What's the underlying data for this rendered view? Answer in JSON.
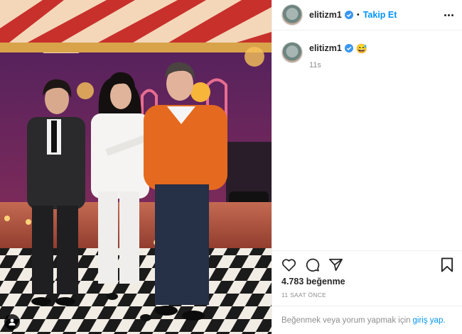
{
  "post": {
    "username": "elitizm1",
    "follow_label": "Takip Et",
    "separator": "•",
    "caption_emoji": "😅",
    "caption_time": "11s",
    "likes": "4.783 beğenme",
    "date": "11 SAAT ÖNCE",
    "footer_text": "Beğenmek veya yorum yapmak için",
    "footer_login": "giriş yap."
  },
  "colors": {
    "accent": "#0095f6",
    "text": "#262626",
    "muted": "#8e8e8e",
    "border": "#efefef",
    "verified": "#3897f0"
  },
  "icons": {
    "header": [
      "verified-badge-icon",
      "more-options-icon"
    ],
    "media": [
      "user-tag-icon"
    ],
    "actions": [
      "heart-icon",
      "comment-icon",
      "share-icon",
      "bookmark-icon"
    ]
  }
}
